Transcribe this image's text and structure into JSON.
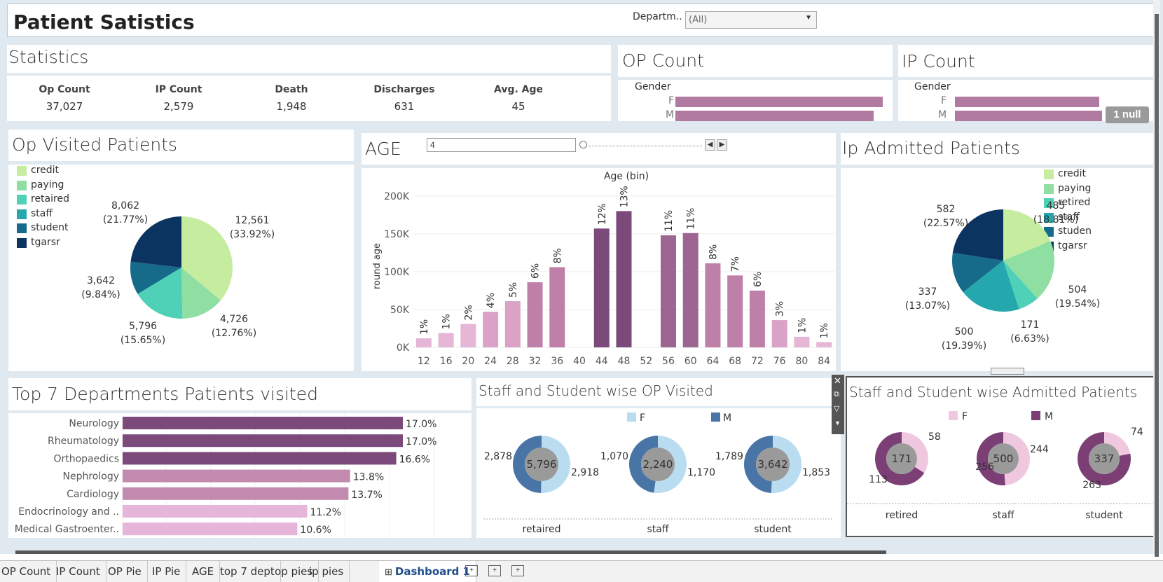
{
  "header": {
    "title": "Patient Satistics",
    "filter_label": "Departm..",
    "filter_value": "(All)"
  },
  "stats": {
    "title": "Statistics",
    "items": [
      {
        "label": "Op Count",
        "value": "37,027"
      },
      {
        "label": "IP Count",
        "value": "2,579"
      },
      {
        "label": "Death",
        "value": "1,948"
      },
      {
        "label": "Discharges",
        "value": "631"
      },
      {
        "label": "Avg. Age",
        "value": "45"
      }
    ]
  },
  "op_count": {
    "title": "OP Count",
    "gender_label": "Gender",
    "f": "F",
    "m": "M"
  },
  "ip_count": {
    "title": "IP Count",
    "gender_label": "Gender",
    "f": "F",
    "m": "M",
    "null_badge": "1 null"
  },
  "op_pie": {
    "title": "Op Visited Patients",
    "legend": [
      "credit",
      "paying",
      "retaired",
      "staff",
      "student",
      "tgarsr"
    ],
    "labels": [
      {
        "v": "12,561",
        "p": "(33.92%)"
      },
      {
        "v": "4,726",
        "p": "(12.76%)"
      },
      {
        "v": "5,796",
        "p": "(15.65%)"
      },
      {
        "v": "3,642",
        "p": "(9.84%)"
      },
      {
        "v": "8,062",
        "p": "(21.77%)"
      }
    ]
  },
  "age": {
    "title": "AGE",
    "slider_value": "4",
    "bin_title": "Age (bin)",
    "ylabel": "round age"
  },
  "ip_pie": {
    "title": "Ip Admitted Patients",
    "legend": [
      "credit",
      "paying",
      "retired",
      "staff",
      "studen",
      "tgarsr"
    ],
    "labels": [
      {
        "v": "485",
        "p": "(18.81%)"
      },
      {
        "v": "504",
        "p": "(19.54%)"
      },
      {
        "v": "171",
        "p": "(6.63%)"
      },
      {
        "v": "500",
        "p": "(19.39%)"
      },
      {
        "v": "337",
        "p": "(13.07%)"
      },
      {
        "v": "582",
        "p": "(22.57%)"
      }
    ]
  },
  "top7": {
    "title": "Top 7 Departments Patients visited"
  },
  "staff_op": {
    "title": "Staff and Student wise OP Visited",
    "leg_f": "F",
    "leg_m": "M",
    "donuts": [
      {
        "total": "5,796",
        "m": "2,878",
        "f": "2,918",
        "cat": "retaired"
      },
      {
        "total": "2,240",
        "m": "1,070",
        "f": "1,170",
        "cat": "staff"
      },
      {
        "total": "3,642",
        "m": "1,789",
        "f": "1,853",
        "cat": "student"
      }
    ]
  },
  "staff_ip": {
    "title": "Staff and Student wise Admitted Patients",
    "leg_f": "F",
    "leg_m": "M",
    "donuts": [
      {
        "total": "171",
        "f": "58",
        "m": "113",
        "cat": "retired"
      },
      {
        "total": "500",
        "f": "244",
        "m": "256",
        "cat": "staff"
      },
      {
        "total": "337",
        "f": "74",
        "m": "263",
        "cat": "student"
      }
    ]
  },
  "tabs": [
    "OP Count",
    "IP Count",
    "OP Pie",
    "IP Pie",
    "AGE",
    "top 7 dept",
    "op pies",
    "ip pies",
    "Dashboard 1"
  ],
  "colors": {
    "mauve": "#b07aa1",
    "dark": "#7b4a7b",
    "f_blue": "#b9dcf0",
    "m_blue": "#4874a6",
    "f_pink": "#efc8e0",
    "m_purple": "#7b3f76"
  },
  "chart_data": [
    {
      "type": "bar",
      "title": "Age (bin)",
      "xlabel": "",
      "ylabel": "round age",
      "categories": [
        "12",
        "16",
        "20",
        "24",
        "28",
        "32",
        "36",
        "40",
        "44",
        "48",
        "52",
        "56",
        "60",
        "64",
        "68",
        "72",
        "76",
        "80",
        "84"
      ],
      "values": [
        12000,
        19000,
        31000,
        47000,
        61000,
        86000,
        106000,
        0,
        157000,
        180000,
        0,
        148000,
        151000,
        111000,
        95000,
        75000,
        36000,
        14000,
        7000
      ],
      "data_labels": [
        "1%",
        "1%",
        "2%",
        "4%",
        "5%",
        "6%",
        "8%",
        "",
        "12%",
        "13%",
        "",
        "11%",
        "11%",
        "8%",
        "7%",
        "6%",
        "3%",
        "1%",
        "1%"
      ],
      "ylim": [
        0,
        210000
      ],
      "yticks": [
        "0K",
        "50K",
        "100K",
        "150K",
        "200K"
      ]
    },
    {
      "type": "bar",
      "orientation": "horizontal",
      "title": "",
      "categories": [
        "Neurology",
        "Rheumatology",
        "Orthopaedics",
        "Nephrology",
        "Cardiology",
        "Endocrinology and ..",
        "Medical Gastroenter.."
      ],
      "values": [
        17.0,
        17.0,
        16.6,
        13.8,
        13.7,
        11.2,
        10.6
      ],
      "data_labels": [
        "17.0%",
        "17.0%",
        "16.6%",
        "13.8%",
        "13.7%",
        "11.2%",
        "10.6%"
      ]
    },
    {
      "type": "pie",
      "title": "Op Visited Patients",
      "categories": [
        "credit",
        "paying",
        "retaired",
        "staff",
        "student",
        "tgarsr"
      ],
      "values": [
        12561,
        4726,
        5796,
        0,
        3642,
        8062
      ]
    },
    {
      "type": "pie",
      "title": "Ip Admitted Patients",
      "categories": [
        "credit",
        "paying",
        "retired",
        "staff",
        "studen",
        "tgarsr"
      ],
      "values": [
        485,
        504,
        171,
        500,
        337,
        582
      ]
    }
  ]
}
